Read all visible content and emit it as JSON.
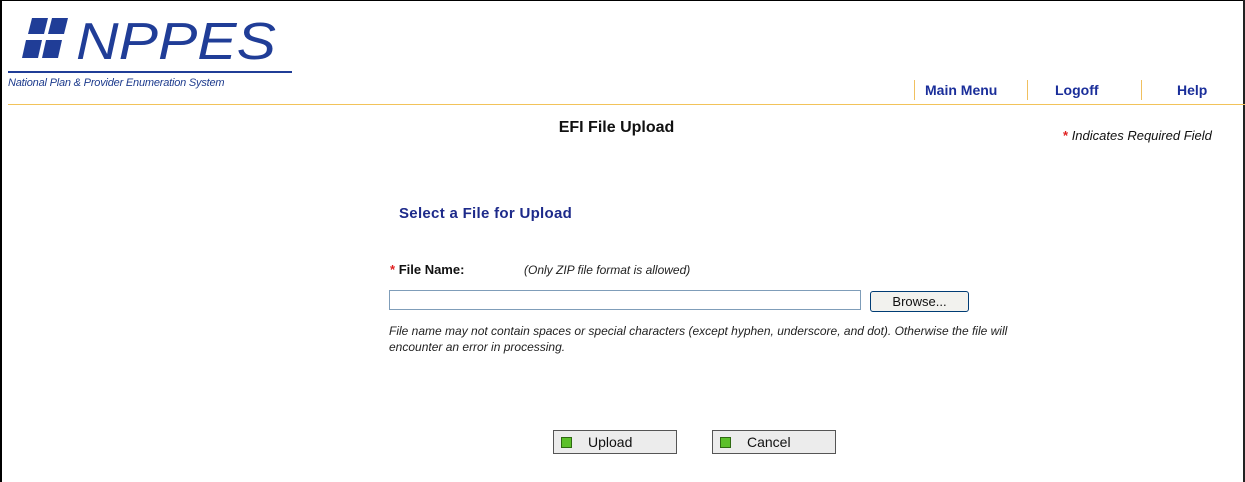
{
  "header": {
    "logo_text": "NPPES",
    "logo_subtitle": "National Plan & Provider Enumeration System"
  },
  "nav": {
    "items": [
      {
        "label": "Main Menu"
      },
      {
        "label": "Logoff"
      },
      {
        "label": "Help"
      }
    ]
  },
  "page": {
    "title": "EFI File Upload",
    "required_legend": {
      "asterisk": "*",
      "text": "Indicates Required Field"
    },
    "section_title": "Select a File for Upload"
  },
  "form": {
    "file_field": {
      "required_marker": "*",
      "label": "File Name:",
      "hint": "(Only ZIP file format is allowed)",
      "value": "",
      "browse_label": "Browse..."
    },
    "help_text": "File name may not contain spaces or special characters (except hyphen, underscore, and dot). Otherwise the file will encounter an error in processing."
  },
  "actions": {
    "upload_label": "Upload",
    "cancel_label": "Cancel"
  },
  "colors": {
    "brand_blue": "#1d3b8d",
    "nav_blue": "#1a2e9a",
    "accent_gold": "#f2c35a",
    "required_red": "#e02020",
    "button_marker_green": "#5cc02a"
  }
}
